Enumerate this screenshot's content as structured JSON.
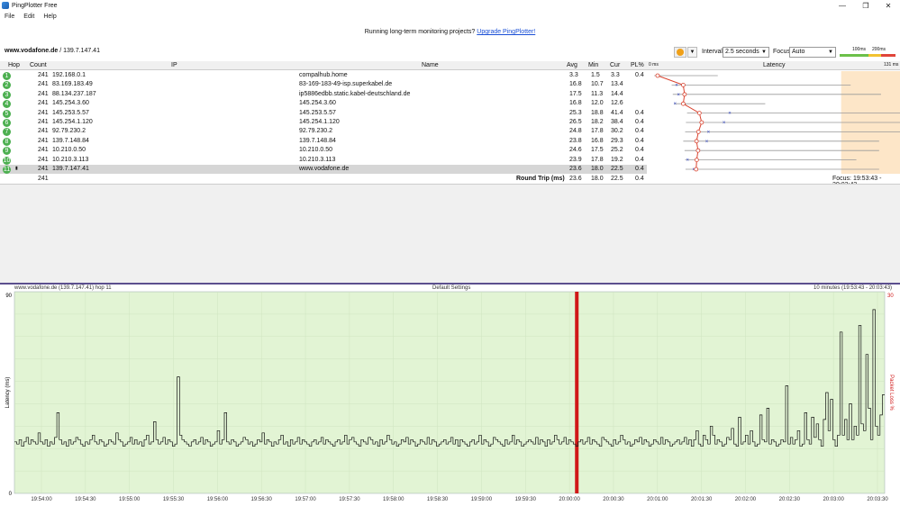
{
  "window": {
    "title": "PingPlotter Free",
    "minimize": "—",
    "maximize": "❐",
    "close": "✕"
  },
  "menu": [
    "File",
    "Edit",
    "Help"
  ],
  "promo": {
    "text": "Running long-term monitoring projects?",
    "link": "Upgrade PingPlotter!"
  },
  "target": {
    "host": "www.vodafone.de",
    "ip": " / 139.7.147.41"
  },
  "controls": {
    "interval_label": "Interval",
    "interval_value": "2.5 seconds",
    "focus_label": "Focus",
    "focus_value": "Auto"
  },
  "scale_legend": {
    "a": "100ms",
    "b": "200ms"
  },
  "columns": {
    "hop": "Hop",
    "count": "Count",
    "ip": "IP",
    "name": "Name",
    "avg": "Avg",
    "min": "Min",
    "cur": "Cur",
    "pl": "PL%",
    "latency": "Latency",
    "lat_start": "0 ms",
    "lat_end": "131 ms"
  },
  "hops": [
    {
      "hop": "1",
      "count": "241",
      "ip": "192.168.0.1",
      "name": "compalhub.home",
      "avg": "3.3",
      "min": "1.5",
      "cur": "3.3",
      "pl": "0.4",
      "lat_avg": 3.3,
      "lat_min": 1.5,
      "lat_max": 35,
      "lat_cur": 3.3
    },
    {
      "hop": "2",
      "count": "241",
      "ip": "83.169.183.49",
      "name": "83-169-183-49-isp.superkabel.de",
      "avg": "16.8",
      "min": "10.7",
      "cur": "13.4",
      "pl": "",
      "lat_avg": 16.8,
      "lat_min": 10.7,
      "lat_max": 105,
      "lat_cur": 13.4
    },
    {
      "hop": "3",
      "count": "241",
      "ip": "88.134.237.187",
      "name": "ip5886edbb.static.kabel-deutschland.de",
      "avg": "17.5",
      "min": "11.3",
      "cur": "14.4",
      "pl": "",
      "lat_avg": 17.5,
      "lat_min": 11.3,
      "lat_max": 121,
      "lat_cur": 14.4
    },
    {
      "hop": "4",
      "count": "241",
      "ip": "145.254.3.60",
      "name": "145.254.3.60",
      "avg": "16.8",
      "min": "12.0",
      "cur": "12.6",
      "pl": "",
      "lat_avg": 16.8,
      "lat_min": 12.0,
      "lat_max": 60,
      "lat_cur": 12.6
    },
    {
      "hop": "5",
      "count": "241",
      "ip": "145.253.5.57",
      "name": "145.253.5.57",
      "avg": "25.3",
      "min": "18.8",
      "cur": "41.4",
      "pl": "0.4",
      "lat_avg": 25.3,
      "lat_min": 18.8,
      "lat_max": 159,
      "lat_cur": 41.4
    },
    {
      "hop": "6",
      "count": "241",
      "ip": "145.254.1.120",
      "name": "145.254.1.120",
      "avg": "26.5",
      "min": "18.2",
      "cur": "38.4",
      "pl": "0.4",
      "lat_avg": 26.5,
      "lat_min": 18.2,
      "lat_max": 200,
      "lat_cur": 38.4
    },
    {
      "hop": "7",
      "count": "241",
      "ip": "92.79.230.2",
      "name": "92.79.230.2",
      "avg": "24.8",
      "min": "17.8",
      "cur": "30.2",
      "pl": "0.4",
      "lat_avg": 24.8,
      "lat_min": 17.8,
      "lat_max": 133,
      "lat_cur": 30.2
    },
    {
      "hop": "8",
      "count": "241",
      "ip": "139.7.148.84",
      "name": "139.7.148.84",
      "avg": "23.8",
      "min": "16.8",
      "cur": "29.3",
      "pl": "0.4",
      "lat_avg": 23.8,
      "lat_min": 16.8,
      "lat_max": 120,
      "lat_cur": 29.3
    },
    {
      "hop": "9",
      "count": "241",
      "ip": "10.210.0.50",
      "name": "10.210.0.50",
      "avg": "24.6",
      "min": "17.5",
      "cur": "25.2",
      "pl": "0.4",
      "lat_avg": 24.6,
      "lat_min": 17.5,
      "lat_max": 120,
      "lat_cur": 25.2
    },
    {
      "hop": "10",
      "count": "241",
      "ip": "10.210.3.113",
      "name": "10.210.3.113",
      "avg": "23.9",
      "min": "17.8",
      "cur": "19.2",
      "pl": "0.4",
      "lat_avg": 23.9,
      "lat_min": 17.8,
      "lat_max": 108,
      "lat_cur": 19.2
    },
    {
      "hop": "11",
      "count": "241",
      "ip": "139.7.147.41",
      "name": "www.vodafone.de",
      "avg": "23.6",
      "min": "18.0",
      "cur": "22.5",
      "pl": "0.4",
      "lat_avg": 23.6,
      "lat_min": 18.0,
      "lat_max": 120,
      "lat_cur": 22.5
    }
  ],
  "summary": {
    "count": "241",
    "label": "Round Trip (ms)",
    "avg": "23.6",
    "min": "18.0",
    "cur": "22.5",
    "pl": "0.4",
    "focus": "Focus: 19:53:43 - 20:03:43"
  },
  "graph": {
    "left_title": "www.vodafone.de (139.7.147.41) hop 11",
    "center_title": "Default Settings",
    "right_title": "10 minutes (19:53:43 - 20:03:43)",
    "y_top": "90",
    "y_bottom": "0",
    "loss_top": "30",
    "ylabel": "Latency (ms)",
    "loss_label": "Packet Loss %"
  },
  "chart_data": {
    "type": "line",
    "ylabel": "Latency (ms)",
    "y2label": "Packet Loss %",
    "ylim": [
      0,
      90
    ],
    "y2lim": [
      0,
      30
    ],
    "x_ticks": [
      "19:54:00",
      "19:54:30",
      "19:55:00",
      "19:55:30",
      "19:56:00",
      "19:56:30",
      "19:57:00",
      "19:57:30",
      "19:58:00",
      "19:58:30",
      "19:59:00",
      "19:59:30",
      "20:00:00",
      "20:00:30",
      "20:01:00",
      "20:01:30",
      "20:02:00",
      "20:02:30",
      "20:03:00",
      "20:03:30"
    ],
    "loss_event_time": "20:00:05",
    "series": [
      {
        "values": [
          23,
          22,
          24,
          21,
          23,
          25,
          22,
          24,
          23,
          22,
          27,
          23,
          22,
          24,
          21,
          23,
          22,
          25,
          36,
          24,
          22,
          23,
          21,
          24,
          22,
          23,
          25,
          24,
          22,
          21,
          23,
          22,
          24,
          26,
          23,
          22,
          24,
          23,
          21,
          22,
          24,
          23,
          22,
          27,
          24,
          23,
          21,
          22,
          23,
          25,
          22,
          24,
          22,
          23,
          21,
          24,
          26,
          22,
          23,
          32,
          24,
          22,
          23,
          25,
          22,
          24,
          23,
          21,
          22,
          52,
          26,
          24,
          23,
          22,
          21,
          23,
          24,
          22,
          23,
          25,
          22,
          24,
          23,
          21,
          22,
          23,
          28,
          22,
          24,
          36,
          23,
          22,
          24,
          23,
          21,
          22,
          23,
          25,
          24,
          22,
          23,
          21,
          22,
          24,
          23,
          27,
          22,
          24,
          23,
          21,
          23,
          22,
          24,
          26,
          22,
          23,
          21,
          24,
          22,
          23,
          25,
          22,
          24,
          23,
          22,
          21,
          23,
          24,
          22,
          23,
          25,
          22,
          24,
          23,
          22,
          21,
          23,
          24,
          22,
          23,
          26,
          22,
          24,
          25,
          23,
          22,
          21,
          24,
          23,
          22,
          25,
          24,
          22,
          23,
          21,
          24,
          22,
          23,
          26,
          24,
          22,
          23,
          21,
          22,
          24,
          23,
          25,
          22,
          24,
          23,
          21,
          22,
          24,
          23,
          22,
          25,
          22,
          24,
          23,
          21,
          22,
          23,
          24,
          22,
          23,
          25,
          22,
          24,
          21,
          24,
          23,
          22,
          21,
          23,
          24,
          22,
          23,
          26,
          22,
          24,
          23,
          21,
          22,
          25,
          24,
          23,
          22,
          21,
          24,
          22,
          23,
          26,
          22,
          24,
          23,
          21,
          22,
          23,
          24,
          23,
          22,
          25,
          22,
          24,
          23,
          21,
          24,
          22,
          23,
          26,
          24,
          22,
          23,
          25,
          22,
          24,
          23,
          22,
          21,
          23,
          24,
          22,
          23,
          25,
          22,
          24,
          23,
          22,
          21,
          25,
          24,
          23,
          22,
          21,
          24,
          22,
          23,
          26,
          24,
          22,
          23,
          21,
          22,
          24,
          23,
          25,
          22,
          24,
          23,
          21,
          22,
          24,
          23,
          22,
          25,
          22,
          24,
          23,
          21,
          22,
          23,
          24,
          22,
          23,
          25,
          22,
          24,
          21,
          24,
          28,
          22,
          21,
          26,
          24,
          22,
          30,
          26,
          22,
          24,
          23,
          21,
          22,
          25,
          24,
          29,
          22,
          21,
          34,
          22,
          23,
          26,
          22,
          28,
          23,
          21,
          22,
          35,
          24,
          23,
          38,
          22,
          24,
          23,
          21,
          22,
          24,
          23,
          48,
          22,
          25,
          22,
          24,
          28,
          21,
          22,
          36,
          24,
          22,
          34,
          25,
          31,
          24,
          21,
          33,
          45,
          28,
          42,
          24,
          21,
          26,
          72,
          26,
          33,
          24,
          40,
          24,
          30,
          26,
          75,
          31,
          28,
          62,
          38,
          24,
          82,
          30,
          26,
          35,
          44
        ]
      }
    ]
  }
}
